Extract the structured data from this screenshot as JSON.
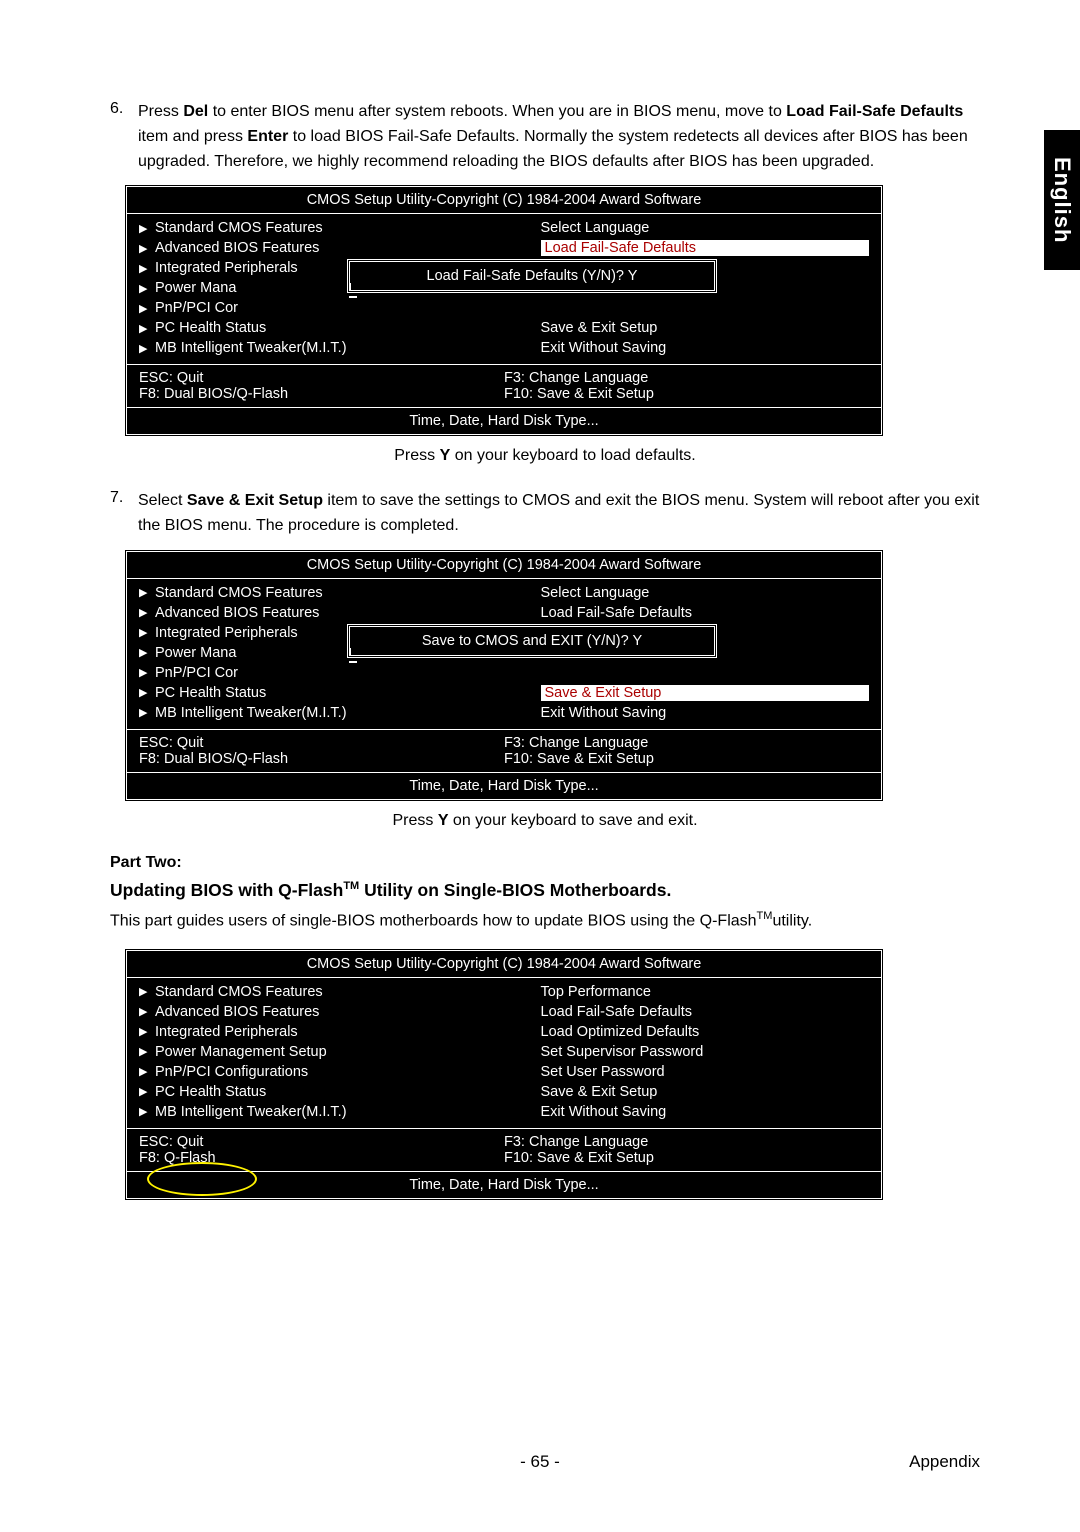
{
  "sideTab": "English",
  "step6": {
    "num": "6.",
    "text_pre": "Press ",
    "bold1": "Del",
    "text_mid": " to enter BIOS menu after system reboots. When you are in BIOS menu, move to ",
    "bold2": "Load Fail-Safe Defaults",
    "text_mid2": " item and press ",
    "bold3": "Enter",
    "text_end": " to load BIOS Fail-Safe Defaults. Normally the system redetects all devices after BIOS has been upgraded. Therefore, we highly recommend reloading the BIOS defaults after BIOS has been upgraded."
  },
  "biosTitle": "CMOS Setup Utility-Copyright (C) 1984-2004 Award Software",
  "left": [
    "Standard CMOS Features",
    "Advanced BIOS Features",
    "Integrated Peripherals",
    "Power Management Setup",
    "PnP/PCI Configurations",
    "PC Health Status",
    "MB Intelligent Tweaker(M.I.T.)"
  ],
  "leftClip": {
    "2": "Integrated Peripherals",
    "3": "Power Mana",
    "4": "PnP/PCI Cor"
  },
  "right1": [
    "Select Language",
    "Load Fail-Safe Defaults",
    "Load Optimized Defaults",
    "",
    "",
    "Save & Exit Setup",
    "Exit Without Saving"
  ],
  "right2": [
    "Select Language",
    "Load Fail-Safe Defaults",
    "Load Optimized Defaults",
    "",
    "",
    "Save & Exit Setup",
    "Exit Without Saving"
  ],
  "right3": [
    "Top Performance",
    "Load Fail-Safe Defaults",
    "Load Optimized Defaults",
    "Set Supervisor Password",
    "Set User Password",
    "Save & Exit Setup",
    "Exit Without Saving"
  ],
  "foot": {
    "esc": "ESC: Quit",
    "f8a": "F8: Dual BIOS/Q-Flash",
    "f8b": "F8: Q-Flash",
    "f3": "F3: Change Language",
    "f10": "F10: Save &  Exit Setup"
  },
  "info": "Time, Date, Hard Disk Type...",
  "dlg1": "Load Fail-Safe Defaults (Y/N)? Y",
  "dlg2": "Save to CMOS and EXIT (Y/N)? Y",
  "sub1": {
    "pre": "Press ",
    "b": "Y",
    "post": " on your keyboard to load defaults."
  },
  "step7": {
    "num": "7.",
    "pre": "Select ",
    "b": "Save & Exit Setup",
    "post": " item to save the settings to CMOS and exit the BIOS menu. System will reboot after you exit the BIOS menu. The procedure is completed."
  },
  "sub2": {
    "pre": "Press ",
    "b": "Y",
    "post": " on your keyboard to save and exit."
  },
  "part2": {
    "h": "Part Two:",
    "sub_pre": "Updating BIOS with Q-Flash",
    "tm": "TM",
    "sub_post": " Utility on Single-BIOS Motherboards.",
    "desc_pre": "This part guides users of single-BIOS motherboards how to update BIOS using the Q-Flash",
    "desc_post": "utility."
  },
  "pageNum": "- 65 -",
  "appendix": "Appendix"
}
